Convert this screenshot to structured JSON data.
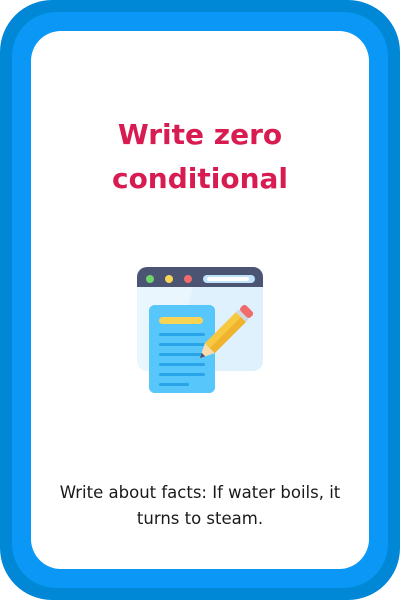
{
  "card": {
    "title": "Write zero conditional",
    "description": "Write about facts: If water boils, it turns to steam.",
    "icon": "browser-notepad-pencil-icon",
    "colors": {
      "border_outer": "#0088d6",
      "border_inner": "#0a97f5",
      "title": "#d81b50",
      "text": "#1a1a1a"
    }
  }
}
